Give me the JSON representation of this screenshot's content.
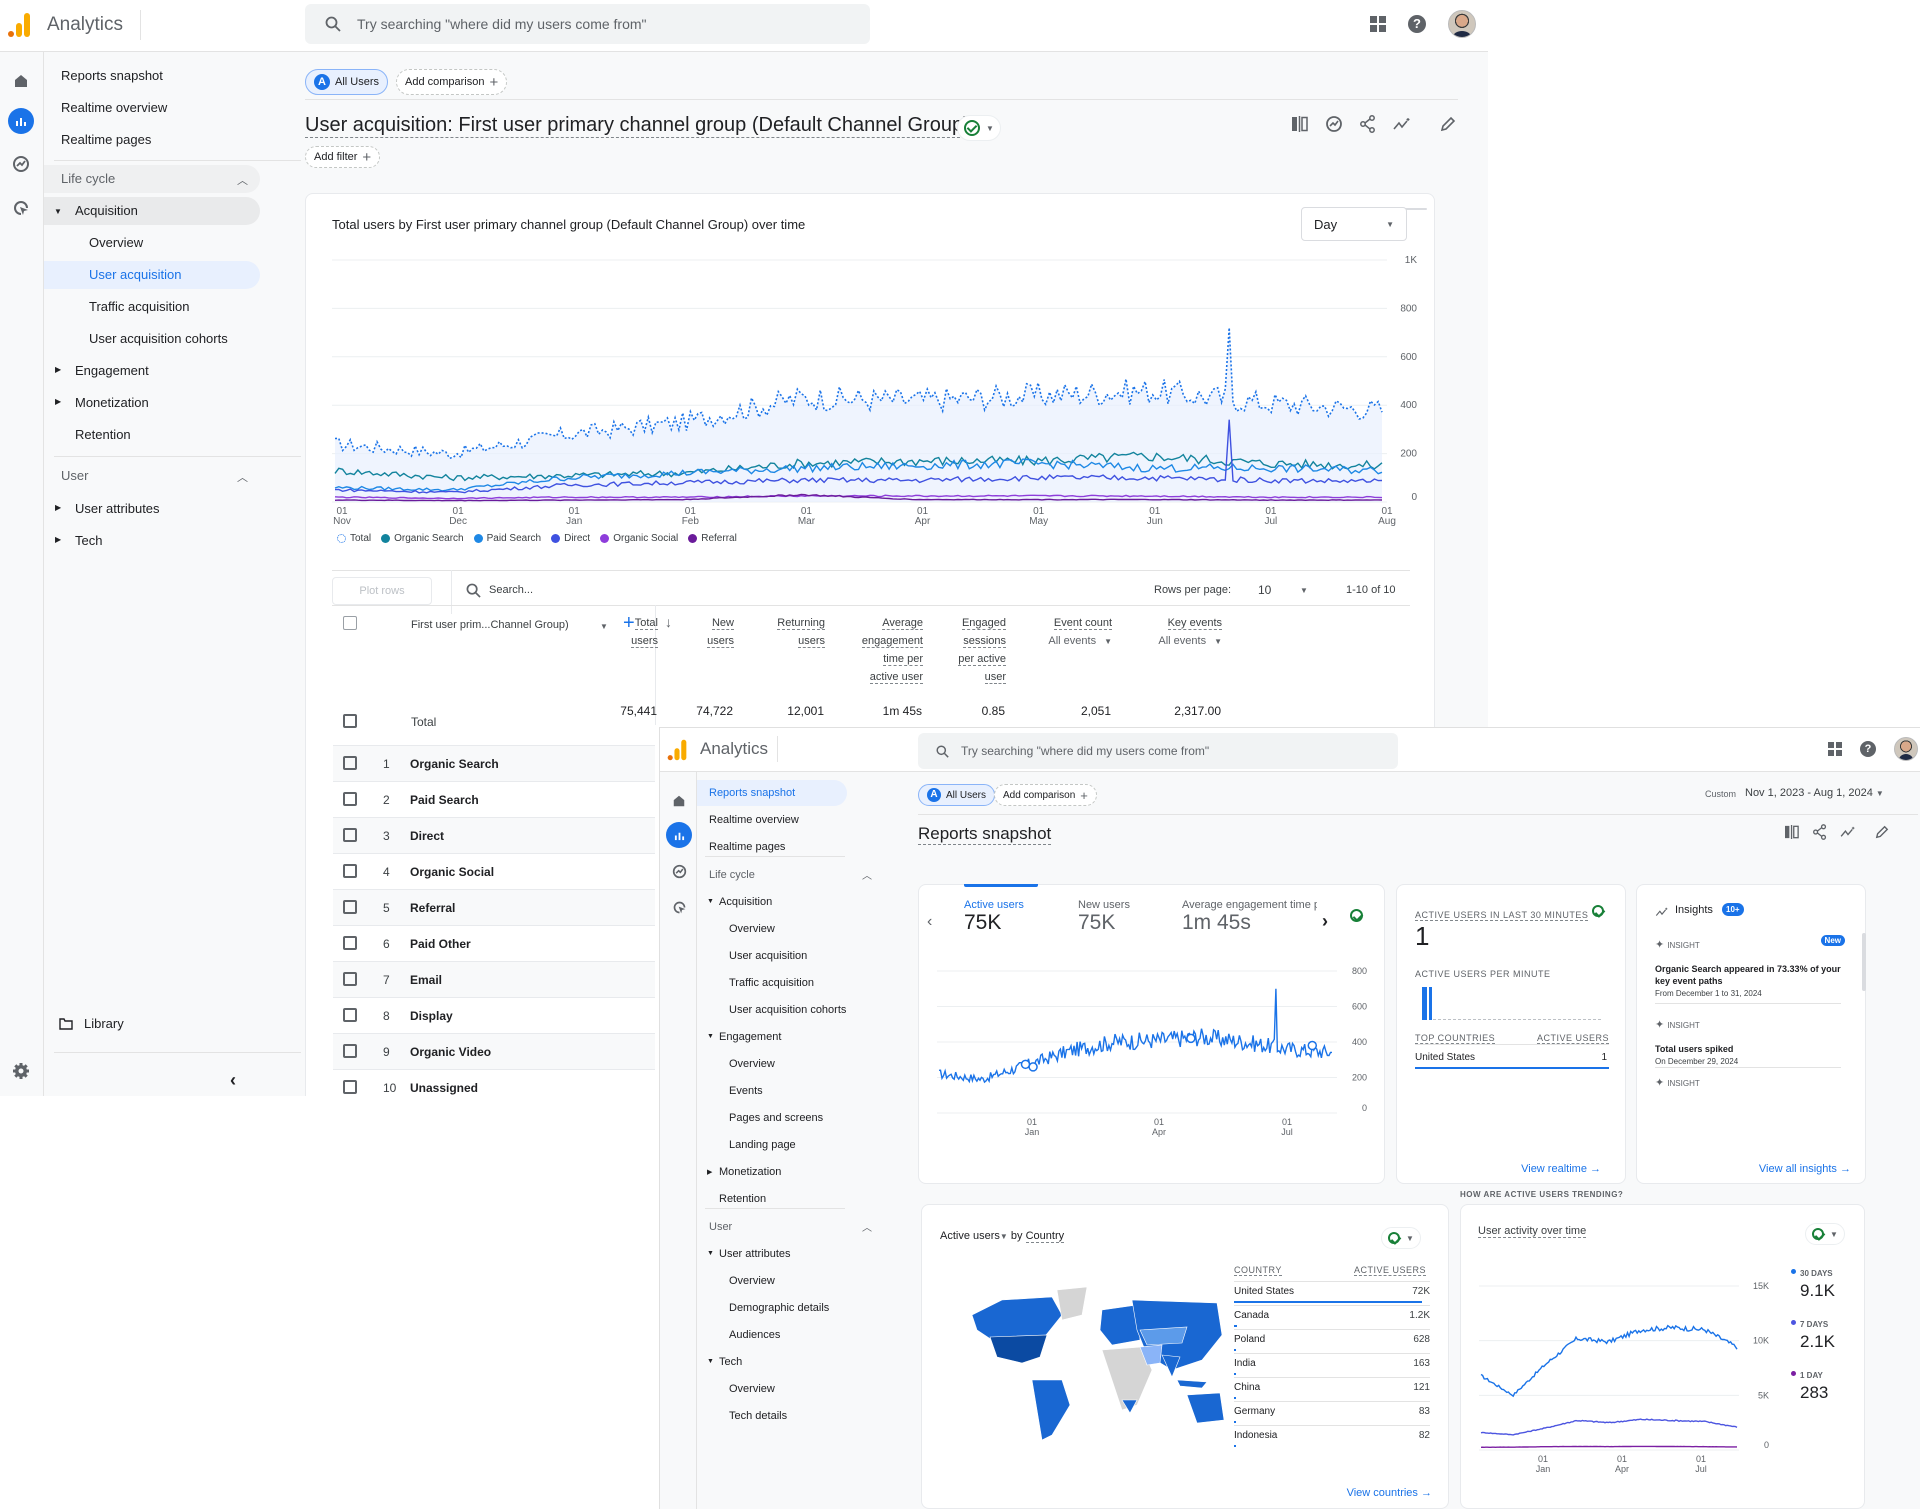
{
  "window1": {
    "app_name": "Analytics",
    "search_placeholder": "Try searching \"where did my users come from\"",
    "header_icons": [
      "apps-grid-icon",
      "help-icon",
      "account-avatar"
    ],
    "rail_icons": [
      "home-icon",
      "reports-icon",
      "explore-icon",
      "advertising-icon"
    ],
    "nav": {
      "top_items": [
        "Reports snapshot",
        "Realtime overview",
        "Realtime pages"
      ],
      "lifecycle_label": "Life cycle",
      "acquisition_label": "Acquisition",
      "acquisition_children": [
        "Overview",
        "User acquisition",
        "Traffic acquisition",
        "User acquisition cohorts"
      ],
      "selected_child": "User acquisition",
      "engagement_label": "Engagement",
      "monetization_label": "Monetization",
      "retention_label": "Retention",
      "user_label": "User",
      "user_attributes_label": "User attributes",
      "tech_label": "Tech",
      "library_label": "Library"
    },
    "comparison": {
      "all_users_badge": "A",
      "all_users": "All Users",
      "add_comparison": "Add comparison"
    },
    "page_title": "User acquisition: First user primary channel group (Default Channel Group)",
    "add_filter": "Add filter",
    "toolbar_icons": [
      "compare-icon",
      "insights-chart-icon",
      "share-icon",
      "trend-icon",
      "edit-icon"
    ],
    "chart_card": {
      "title": "Total users by First user primary channel group (Default Channel Group) over time",
      "granularity": "Day"
    },
    "table": {
      "plot_rows": "Plot rows",
      "search_placeholder": "Search...",
      "rows_per_page_label": "Rows per page:",
      "rows_per_page": "10",
      "pagination": "1-10 of 10",
      "dimension_header": "First user prim...Channel Group)",
      "columns": [
        {
          "lines": [
            "Total",
            "users"
          ]
        },
        {
          "lines": [
            "New",
            "users"
          ]
        },
        {
          "lines": [
            "Returning",
            "users"
          ]
        },
        {
          "lines": [
            "Average",
            "engagement",
            "time per",
            "active user"
          ]
        },
        {
          "lines": [
            "Engaged",
            "sessions",
            "per active",
            "user"
          ]
        },
        {
          "lines": [
            "Event count"
          ],
          "sub": "All events"
        },
        {
          "lines": [
            "Key events"
          ],
          "sub": "All events"
        }
      ],
      "total_label": "Total",
      "totals": [
        "75,441",
        "74,722",
        "12,001",
        "1m 45s",
        "0.85",
        "2,051",
        "2,317.00"
      ],
      "rows": [
        {
          "n": "1",
          "label": "Organic Search"
        },
        {
          "n": "2",
          "label": "Paid Search"
        },
        {
          "n": "3",
          "label": "Direct"
        },
        {
          "n": "4",
          "label": "Organic Social"
        },
        {
          "n": "5",
          "label": "Referral"
        },
        {
          "n": "6",
          "label": "Paid Other"
        },
        {
          "n": "7",
          "label": "Email"
        },
        {
          "n": "8",
          "label": "Display"
        },
        {
          "n": "9",
          "label": "Organic Video"
        },
        {
          "n": "10",
          "label": "Unassigned"
        }
      ]
    }
  },
  "window2": {
    "app_name": "Analytics",
    "search_placeholder": "Try searching \"where did my users come from\"",
    "nav": {
      "top_items": [
        "Reports snapshot",
        "Realtime overview",
        "Realtime pages"
      ],
      "selected": "Reports snapshot",
      "lifecycle_label": "Life cycle",
      "acquisition_label": "Acquisition",
      "acquisition_children": [
        "Overview",
        "User acquisition",
        "Traffic acquisition",
        "User acquisition cohorts"
      ],
      "engagement_label": "Engagement",
      "engagement_children": [
        "Overview",
        "Events",
        "Pages and screens",
        "Landing page"
      ],
      "monetization_label": "Monetization",
      "retention_label": "Retention",
      "user_label": "User",
      "user_attributes_label": "User attributes",
      "user_attributes_children": [
        "Overview",
        "Demographic details",
        "Audiences"
      ],
      "tech_label": "Tech",
      "tech_children": [
        "Overview",
        "Tech details"
      ]
    },
    "comparison": {
      "all_users_badge": "A",
      "all_users": "All Users",
      "add_comparison": "Add comparison"
    },
    "date_range": {
      "label": "Custom",
      "value": "Nov 1, 2023 - Aug 1, 2024"
    },
    "page_title": "Reports snapshot",
    "kpis": [
      {
        "label": "Active users",
        "value": "75K",
        "active": true
      },
      {
        "label": "New users",
        "value": "75K"
      },
      {
        "label": "Average engagement time p",
        "value": "1m 45s"
      }
    ],
    "realtime": {
      "title": "ACTIVE USERS IN LAST 30 MINUTES",
      "value": "1",
      "per_minute_label": "ACTIVE USERS PER MINUTE",
      "top_countries_label": "TOP COUNTRIES",
      "active_users_label": "ACTIVE USERS",
      "country": "United States",
      "country_value": "1",
      "link": "View realtime"
    },
    "insights": {
      "title": "Insights",
      "badge": "10+",
      "items": [
        {
          "tag": "INSIGHT",
          "new": "New",
          "text": "Organic Search appeared in 73.33% of your key event paths",
          "date": "From December 1 to 31, 2024"
        },
        {
          "tag": "INSIGHT",
          "text": "Total users spiked",
          "date": "On December 29, 2024"
        },
        {
          "tag": "INSIGHT"
        }
      ],
      "link": "View all insights"
    },
    "country_card": {
      "metric": "Active users",
      "by": "by",
      "dimension": "Country",
      "col_country": "COUNTRY",
      "col_users": "ACTIVE USERS",
      "rows": [
        {
          "country": "United States",
          "value": "72K",
          "share": 0.96
        },
        {
          "country": "Canada",
          "value": "1.2K",
          "share": 0.016
        },
        {
          "country": "Poland",
          "value": "628",
          "share": 0.008
        },
        {
          "country": "India",
          "value": "163",
          "share": 0.003
        },
        {
          "country": "China",
          "value": "121",
          "share": 0.002
        },
        {
          "country": "Germany",
          "value": "83",
          "share": 0.001
        },
        {
          "country": "Indonesia",
          "value": "82",
          "share": 0.001
        }
      ],
      "link": "View countries"
    },
    "trend_section_label": "HOW ARE ACTIVE USERS TRENDING?",
    "activity_card": {
      "title": "User activity over time",
      "legend": [
        {
          "label": "30 DAYS",
          "value": "9.1K",
          "color": "#1a73e8"
        },
        {
          "label": "7 DAYS",
          "value": "2.1K",
          "color": "#4c55e0"
        },
        {
          "label": "1 DAY",
          "value": "283",
          "color": "#7b1fa2"
        }
      ]
    }
  },
  "chart_data": [
    {
      "type": "line",
      "title": "Total users by First user primary channel group (Default Channel Group) over time",
      "xlabel": "",
      "ylabel": "",
      "x_ticks": [
        [
          "01",
          "Nov"
        ],
        [
          "01",
          "Dec"
        ],
        [
          "01",
          "Jan"
        ],
        [
          "01",
          "Feb"
        ],
        [
          "01",
          "Mar"
        ],
        [
          "01",
          "Apr"
        ],
        [
          "01",
          "May"
        ],
        [
          "01",
          "Jun"
        ],
        [
          "01",
          "Jul"
        ],
        [
          "01",
          "Aug"
        ]
      ],
      "y_ticks": [
        "0",
        "200",
        "400",
        "600",
        "800",
        "1K"
      ],
      "ylim": [
        0,
        1000
      ],
      "legend_position": "bottom-left",
      "series": [
        {
          "name": "Total",
          "color": "#1a73e8",
          "style": "dotted",
          "monthly_values": [
            240,
            200,
            280,
            330,
            430,
            420,
            440,
            460,
            410,
            380
          ],
          "spike": {
            "month_index": 7.7,
            "value": 720
          }
        },
        {
          "name": "Organic Search",
          "color": "#12839d",
          "monthly_values": [
            130,
            100,
            110,
            120,
            160,
            170,
            170,
            190,
            160,
            150
          ]
        },
        {
          "name": "Paid Search",
          "color": "#1e88e5",
          "monthly_values": [
            60,
            50,
            100,
            120,
            140,
            150,
            160,
            140,
            140,
            130
          ]
        },
        {
          "name": "Direct",
          "color": "#3f51e0",
          "monthly_values": [
            50,
            40,
            70,
            80,
            90,
            90,
            100,
            100,
            90,
            85
          ],
          "spike": {
            "month_index": 7.7,
            "value": 340
          }
        },
        {
          "name": "Organic Social",
          "color": "#8e3ddb",
          "monthly_values": [
            20,
            15,
            20,
            20,
            25,
            25,
            25,
            25,
            20,
            20
          ]
        },
        {
          "name": "Referral",
          "color": "#6a1b9a",
          "monthly_values": [
            8,
            6,
            8,
            10,
            30,
            10,
            10,
            10,
            8,
            8
          ]
        }
      ]
    },
    {
      "type": "line",
      "title": "Active users",
      "x_ticks": [
        [
          "01",
          "Jan"
        ],
        [
          "01",
          "Apr"
        ],
        [
          "01",
          "Jul"
        ]
      ],
      "y_ticks": [
        "0",
        "200",
        "400",
        "600",
        "800"
      ],
      "ylim": [
        0,
        800
      ],
      "series": [
        {
          "name": "Active users",
          "color": "#1a73e8",
          "monthly_values": [
            220,
            190,
            270,
            350,
            400,
            410,
            430,
            400,
            360,
            340
          ],
          "spike": {
            "month_index": 7.7,
            "value": 700
          }
        }
      ]
    },
    {
      "type": "line",
      "title": "User activity over time",
      "x_ticks": [
        [
          "01",
          "Jan"
        ],
        [
          "01",
          "Apr"
        ],
        [
          "01",
          "Jul"
        ]
      ],
      "y_ticks": [
        "0",
        "5K",
        "10K",
        "15K"
      ],
      "ylim": [
        0,
        15000
      ],
      "series": [
        {
          "name": "30 DAYS",
          "color": "#1a73e8",
          "monthly_values": [
            6800,
            5000,
            7800,
            10200,
            9900,
            11000,
            11200,
            11000,
            9400
          ]
        },
        {
          "name": "7 DAYS",
          "color": "#4c55e0",
          "monthly_values": [
            1600,
            1400,
            2000,
            2700,
            2500,
            2800,
            2700,
            2600,
            2100
          ]
        },
        {
          "name": "1 DAY",
          "color": "#7b1fa2",
          "monthly_values": [
            250,
            260,
            300,
            320,
            310,
            330,
            320,
            300,
            283
          ]
        }
      ]
    },
    {
      "type": "heatmap",
      "title": "Active users by Country",
      "note": "choropleth world map; darkest: United States",
      "categories": [
        "United States",
        "Canada",
        "Poland",
        "India",
        "China",
        "Germany",
        "Indonesia"
      ],
      "values": [
        72000,
        1200,
        628,
        163,
        121,
        83,
        82
      ]
    }
  ]
}
